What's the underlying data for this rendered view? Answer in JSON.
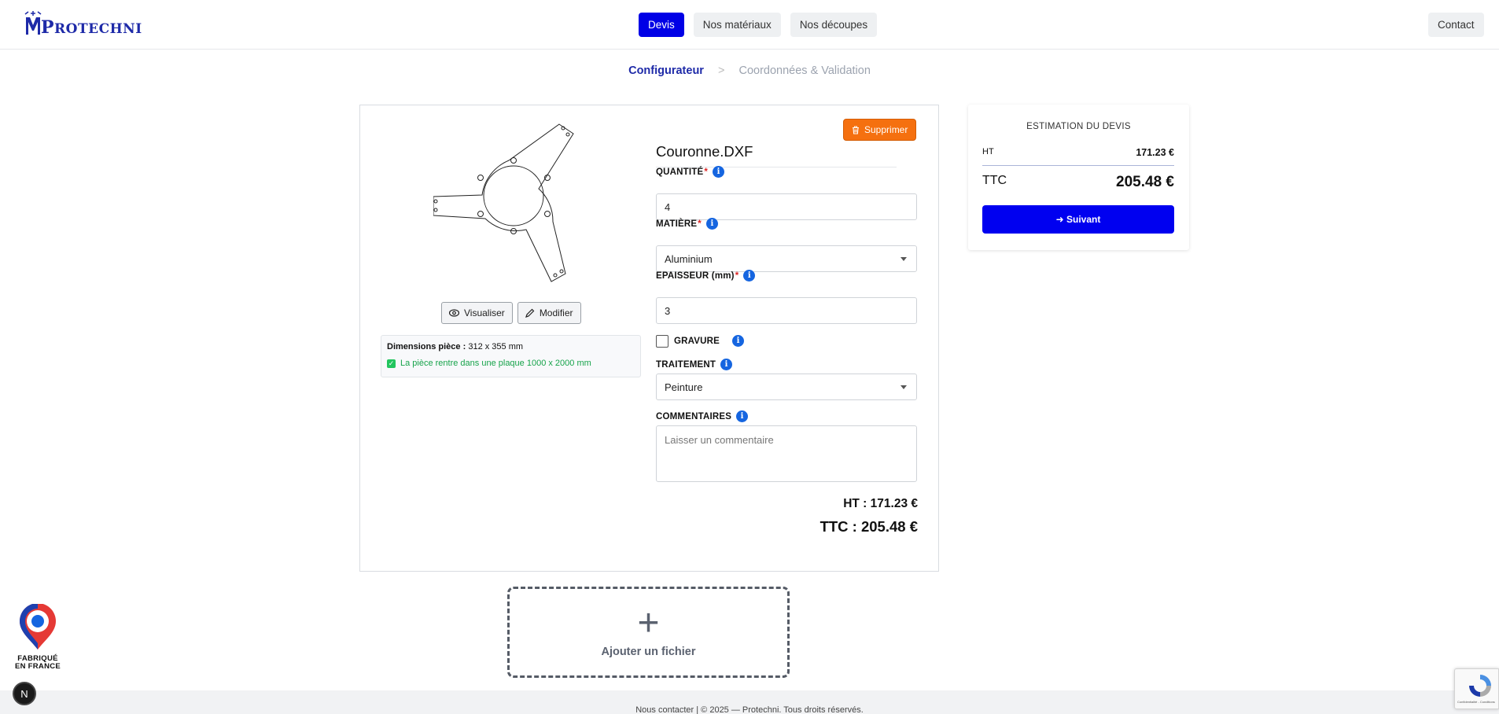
{
  "brand": {
    "name_first": "P",
    "name_rest": "ROTECHNI"
  },
  "nav": {
    "items": [
      "Devis",
      "Nos matériaux",
      "Nos découpes"
    ],
    "active": "Devis",
    "contact": "Contact"
  },
  "breadcrumb": {
    "step1": "Configurateur",
    "separator": ">",
    "step2": "Coordonnées & Validation"
  },
  "part": {
    "delete_label": "Supprimer",
    "file_name": "Couronne.DXF",
    "view_label": "Visualiser",
    "edit_label": "Modifier",
    "dims_label": "Dimensions pièce :",
    "dims_value": "312 x 355 mm",
    "fit_text": "La pièce rentre dans une plaque 1000 x 2000 mm"
  },
  "form": {
    "quantity": {
      "label": "QUANTITÉ",
      "required": "*",
      "value": "4"
    },
    "material": {
      "label": "MATIÈRE",
      "required": "*",
      "value": "Aluminium"
    },
    "thickness": {
      "label": "EPAISSEUR (mm)",
      "required": "*",
      "value": "3"
    },
    "engraving": {
      "label": "GRAVURE",
      "checked": false
    },
    "treatment": {
      "label": "TRAITEMENT",
      "value": "Peinture"
    },
    "comments": {
      "label": "COMMENTAIRES",
      "placeholder": "Laisser un commentaire"
    },
    "info_glyph": "i"
  },
  "price": {
    "ht": "HT : 171.23 €",
    "ttc": "TTC : 205.48 €"
  },
  "add_file": {
    "plus": "+",
    "label": "Ajouter un fichier"
  },
  "summary": {
    "title": "ESTIMATION DU DEVIS",
    "ht_label": "HT",
    "ht_value": "171.23 €",
    "ttc_label": "TTC",
    "ttc_value": "205.48 €",
    "next_label": "➜ Suivant"
  },
  "badge": {
    "line1": "FABRIQUÉ",
    "line2": "EN FRANCE",
    "n": "N"
  },
  "footer": {
    "text": "Nous contacter  |  © 2025 — Protechni. Tous droits réservés."
  },
  "recaptcha": {
    "text": "Confidentialité - Conditions"
  },
  "colors": {
    "primary": "#0000e6",
    "brand": "#1e2aa8",
    "danger": "#f5700f",
    "success": "#16a34a",
    "info": "#1565e0"
  }
}
